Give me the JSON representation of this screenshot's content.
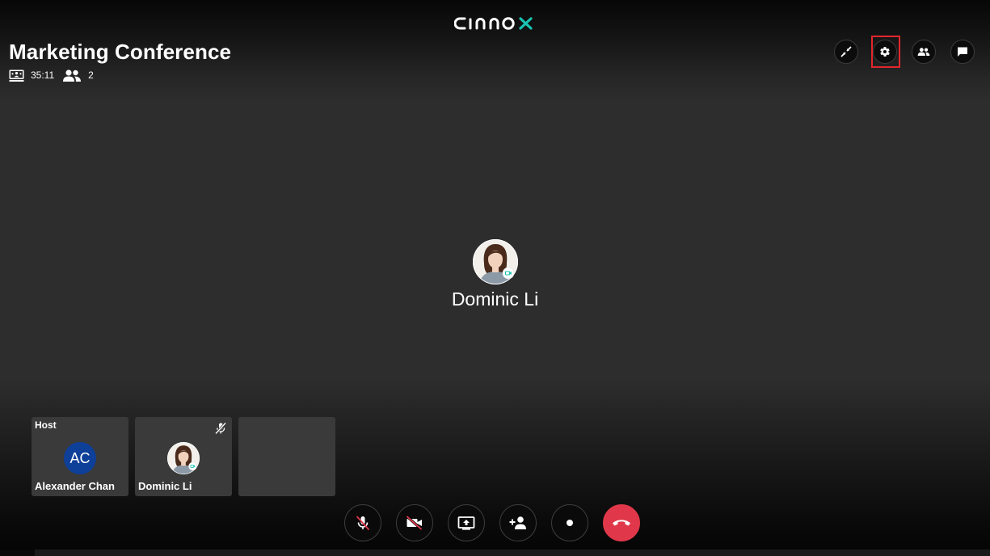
{
  "brand": {
    "logo_text": "cinnox",
    "accent": "#19c3b0"
  },
  "meeting": {
    "title": "Marketing Conference",
    "duration": "35:11",
    "participant_count": "2"
  },
  "top_actions": [
    {
      "icon": "minimize-icon"
    },
    {
      "icon": "gear-icon",
      "highlighted": true
    },
    {
      "icon": "participants-icon"
    },
    {
      "icon": "chat-icon"
    }
  ],
  "speaker": {
    "name": "Dominic Li"
  },
  "tiles": [
    {
      "tag": "Host",
      "name": "Alexander Chan",
      "initials": "AC",
      "avatar_color": "#0e3f99"
    },
    {
      "tag": "",
      "name": "Dominic Li",
      "muted": true
    },
    {
      "tag": "",
      "name": ""
    }
  ],
  "controls": [
    {
      "icon": "mic-off-icon"
    },
    {
      "icon": "camera-off-icon"
    },
    {
      "icon": "share-screen-icon"
    },
    {
      "icon": "add-participant-icon"
    },
    {
      "icon": "record-icon"
    },
    {
      "icon": "end-call-icon",
      "color": "#e0384a"
    }
  ],
  "colors": {
    "highlight": "#e3262d",
    "end_call": "#e0384a",
    "background": "#2d2d2d"
  },
  "progress": 0.035
}
